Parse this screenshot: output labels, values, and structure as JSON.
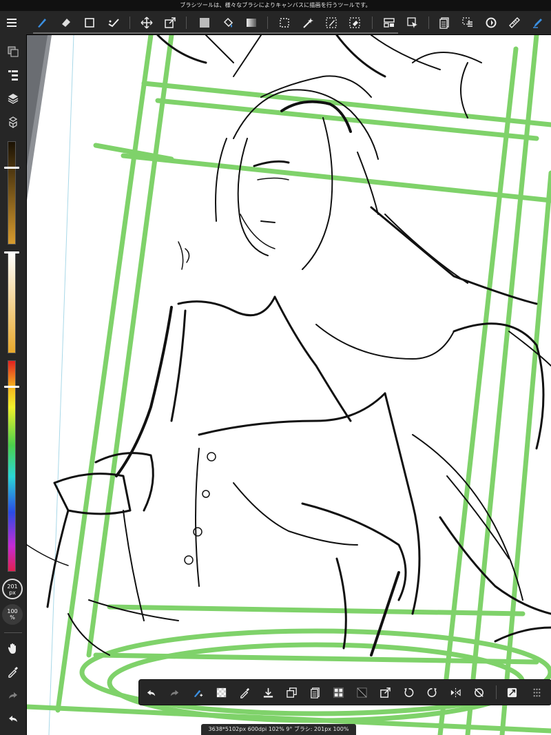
{
  "status_bar": {
    "text": "ブラシツールは、様々なブラシによりキャンバスに描画を行うツールです。"
  },
  "top_toolbar": {
    "tools": [
      {
        "name": "menu-icon"
      },
      {
        "name": "brush-icon",
        "active": true
      },
      {
        "name": "eraser-icon"
      },
      {
        "name": "shape-icon"
      },
      {
        "name": "edit-icon"
      },
      {
        "name": "move-icon"
      },
      {
        "name": "transform-icon"
      },
      {
        "name": "fill-color-icon"
      },
      {
        "name": "bucket-icon"
      },
      {
        "name": "gradient-icon"
      },
      {
        "name": "select-rect-icon"
      },
      {
        "name": "magic-wand-icon"
      },
      {
        "name": "select-pen-icon"
      },
      {
        "name": "select-eraser-icon"
      },
      {
        "name": "panel-layout-icon"
      },
      {
        "name": "select-arrow-icon"
      },
      {
        "name": "pages-icon"
      },
      {
        "name": "layer-select-icon"
      },
      {
        "name": "rotate-icon"
      },
      {
        "name": "ruler-icon"
      },
      {
        "name": "pen-setting-icon"
      }
    ]
  },
  "left_toolbar": {
    "brush_size_value": "201",
    "brush_size_unit": "px",
    "opacity_value": "100",
    "opacity_unit": "%",
    "brush_size_slider_level": 0.17,
    "opacity_slider_level": 0.0,
    "hue_slider_level": 0.12,
    "color_primary": "#d79b2e"
  },
  "bottom_toolbar": {
    "buttons": [
      "undo-icon",
      "redo-icon",
      "brush-adjust-icon",
      "transparent-icon",
      "eyedropper-icon",
      "download-icon",
      "copy-icon",
      "paste-icon",
      "grid-icon",
      "clear-icon",
      "export-icon",
      "rotate-ccw-icon",
      "rotate-cw-icon",
      "flip-icon",
      "reset-icon",
      "snap-icon",
      "more-icon"
    ]
  },
  "canvas_info": {
    "text": "3638*5102px 600dpi 102% 9° ブラシ: 201px 100%"
  },
  "colors": {
    "accent": "#3b8fe0",
    "guide_green": "#7fd26a",
    "toolbar_bg": "#262626"
  }
}
